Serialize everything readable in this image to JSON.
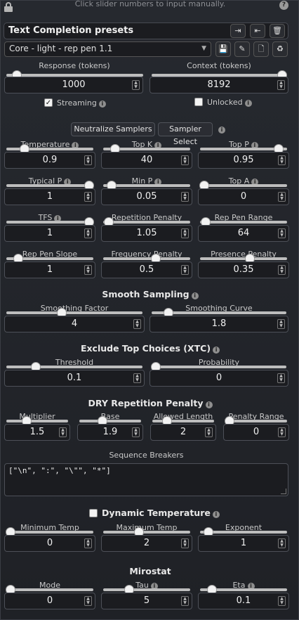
{
  "hint": "Click slider numbers to input manually.",
  "preset_header": {
    "title": "Text Completion presets",
    "buttons": [
      "import-icon",
      "export-icon",
      "delete-icon"
    ]
  },
  "preset_select": {
    "value": "Core - light - rep pen 1.1"
  },
  "preset_buttons": [
    "save-icon",
    "edit-icon",
    "new-file-icon",
    "restore-icon"
  ],
  "response": {
    "label": "Response (tokens)",
    "value": "1000",
    "level": 0.05
  },
  "context": {
    "label": "Context (tokens)",
    "value": "8192",
    "level": 1.0
  },
  "streaming": {
    "label": "Streaming",
    "checked": true
  },
  "unlocked": {
    "label": "Unlocked",
    "checked": false
  },
  "buttons": {
    "neutralize": "Neutralize Samplers",
    "sampler_select": "Sampler Select"
  },
  "samplers": {
    "temperature": {
      "label": "Temperature",
      "value": "0.9",
      "level": 0.18
    },
    "top_k": {
      "label": "Top K",
      "value": "40",
      "level": 0.1
    },
    "top_p": {
      "label": "Top P",
      "value": "0.95",
      "level": 0.95
    },
    "typical_p": {
      "label": "Typical P",
      "value": "1",
      "level": 1.0
    },
    "min_p": {
      "label": "Min P",
      "value": "0.05",
      "level": 0.05
    },
    "top_a": {
      "label": "Top A",
      "value": "0",
      "level": 0.0
    },
    "tfs": {
      "label": "TFS",
      "value": "1",
      "level": 1.0
    },
    "rep_pen": {
      "label": "Repetition Penalty",
      "value": "1.05",
      "level": 0.02
    },
    "rep_pen_range": {
      "label": "Rep Pen Range",
      "value": "64",
      "level": 0.02
    },
    "rep_pen_slope": {
      "label": "Rep Pen Slope",
      "value": "1",
      "level": 0.1
    },
    "freq_pen": {
      "label": "Frequency Penalty",
      "value": "0.5",
      "level": 0.62
    },
    "pres_pen": {
      "label": "Presence Penalty",
      "value": "0.35",
      "level": 0.58
    }
  },
  "smooth": {
    "title": "Smooth Sampling",
    "factor": {
      "label": "Smoothing Factor",
      "value": "4",
      "level": 0.4
    },
    "curve": {
      "label": "Smoothing Curve",
      "value": "1.8",
      "level": 0.1
    }
  },
  "xtc": {
    "title": "Exclude Top Choices (XTC)",
    "threshold": {
      "label": "Threshold",
      "value": "0.1",
      "level": 0.2
    },
    "probability": {
      "label": "Probability",
      "value": "0",
      "level": 0.0
    }
  },
  "dry": {
    "title": "DRY Repetition Penalty",
    "multiplier": {
      "label": "Multiplier",
      "value": "1.5",
      "level": 0.3
    },
    "base": {
      "label": "Base",
      "value": "1.9",
      "level": 0.35
    },
    "allowed_length": {
      "label": "Allowed Length",
      "value": "2",
      "level": 0.2
    },
    "penalty_range": {
      "label": "Penalty Range",
      "value": "0",
      "level": 0.0
    },
    "sequence_breakers_label": "Sequence Breakers",
    "sequence_breakers": "[\"\\n\", \":\", \"\\\"\", \"*\"]"
  },
  "dyn_temp": {
    "title": "Dynamic Temperature",
    "checked": false,
    "min": {
      "label": "Minimum Temp",
      "value": "0",
      "level": 0.0
    },
    "max": {
      "label": "Maximum Temp",
      "value": "2",
      "level": 0.4
    },
    "exponent": {
      "label": "Exponent",
      "value": "1",
      "level": 0.05
    }
  },
  "mirostat": {
    "title": "Mirostat",
    "mode": {
      "label": "Mode",
      "value": "0",
      "level": 0.0
    },
    "tau": {
      "label": "Tau",
      "value": "5",
      "level": 0.28
    },
    "eta": {
      "label": "Eta",
      "value": "0.1",
      "level": 0.1
    }
  }
}
